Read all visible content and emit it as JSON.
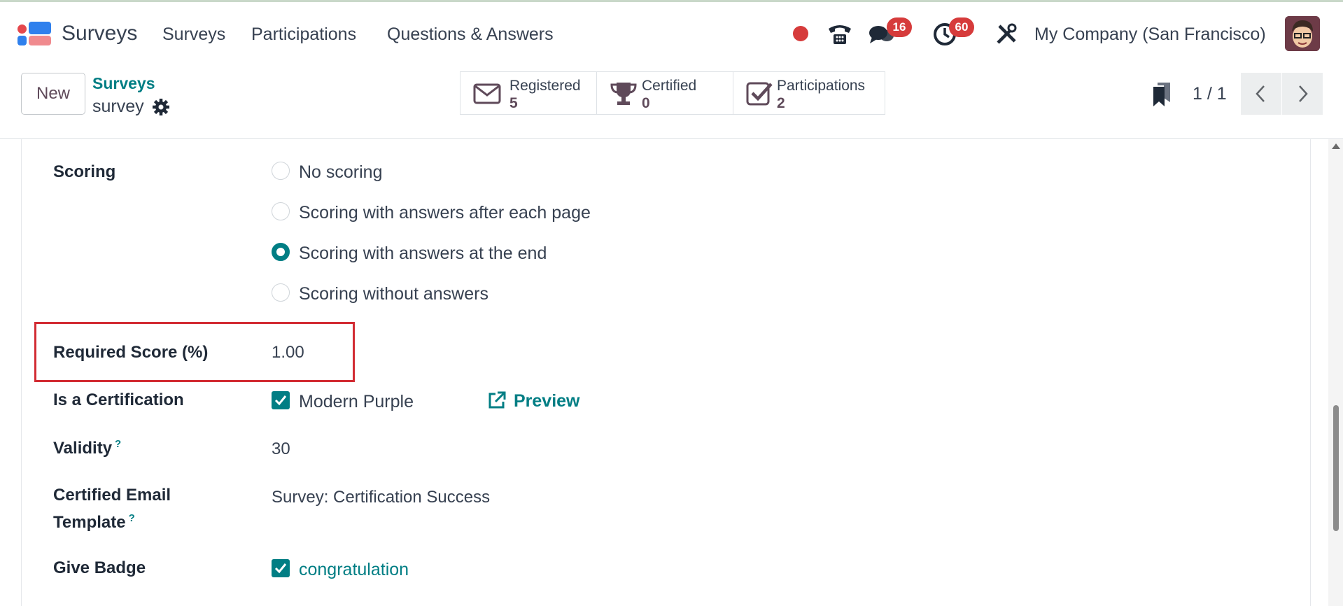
{
  "app": {
    "title": "Surveys"
  },
  "nav": [
    "Surveys",
    "Participations",
    "Questions & Answers"
  ],
  "systray": {
    "messages_count": "16",
    "activities_count": "60",
    "company": "My Company (San Francisco)"
  },
  "control": {
    "new_label": "New",
    "breadcrumb_parent": "Surveys",
    "breadcrumb_current": "survey",
    "stats": [
      {
        "label": "Registered",
        "value": "5",
        "icon": "envelope-icon"
      },
      {
        "label": "Certified",
        "value": "0",
        "icon": "trophy-icon"
      },
      {
        "label": "Participations",
        "value": "2",
        "icon": "check-square-icon"
      }
    ],
    "pager": "1 / 1"
  },
  "form": {
    "scoring_label": "Scoring",
    "scoring_options": [
      {
        "label": "No scoring",
        "selected": false
      },
      {
        "label": "Scoring with answers after each page",
        "selected": false
      },
      {
        "label": "Scoring with answers at the end",
        "selected": true
      },
      {
        "label": "Scoring without answers",
        "selected": false
      }
    ],
    "required_score_label": "Required Score (%)",
    "required_score_value": "1.00",
    "certification_label": "Is a Certification",
    "certification_template": "Modern Purple",
    "preview_label": "Preview",
    "validity_label": "Validity",
    "validity_help": "?",
    "validity_value": "30",
    "email_template_label_line1": "Certified Email",
    "email_template_label_line2": "Template",
    "email_template_help": "?",
    "email_template_value": "Survey: Certification Success",
    "badge_label": "Give Badge",
    "badge_value": "congratulation"
  },
  "colors": {
    "accent": "#017e84",
    "badge": "#d63b3b",
    "highlight": "#d22c33"
  }
}
